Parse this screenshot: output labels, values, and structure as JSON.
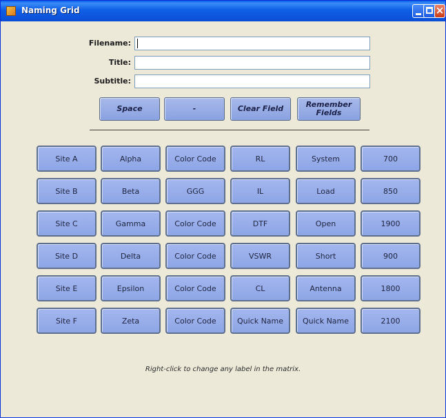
{
  "window": {
    "title": "Naming Grid",
    "icon": "app-icon"
  },
  "form": {
    "filename_label": "Filename:",
    "filename_value": "",
    "title_label": "Title:",
    "title_value": "",
    "subtitle_label": "Subtitle:",
    "subtitle_value": ""
  },
  "actions": {
    "space": "Space",
    "dash": "-",
    "clear": "Clear Field",
    "remember": "Remember Fields"
  },
  "grid": [
    [
      "Site A",
      "Alpha",
      "Color Code",
      "RL",
      "System",
      "700"
    ],
    [
      "Site B",
      "Beta",
      "GGG",
      "IL",
      "Load",
      "850"
    ],
    [
      "Site C",
      "Gamma",
      "Color Code",
      "DTF",
      "Open",
      "1900"
    ],
    [
      "Site D",
      "Delta",
      "Color Code",
      "VSWR",
      "Short",
      "900"
    ],
    [
      "Site E",
      "Epsilon",
      "Color Code",
      "CL",
      "Antenna",
      "1800"
    ],
    [
      "Site F",
      "Zeta",
      "Color Code",
      "Quick Name",
      "Quick Name",
      "2100"
    ]
  ],
  "hint": "Right-click to change any label in the matrix."
}
